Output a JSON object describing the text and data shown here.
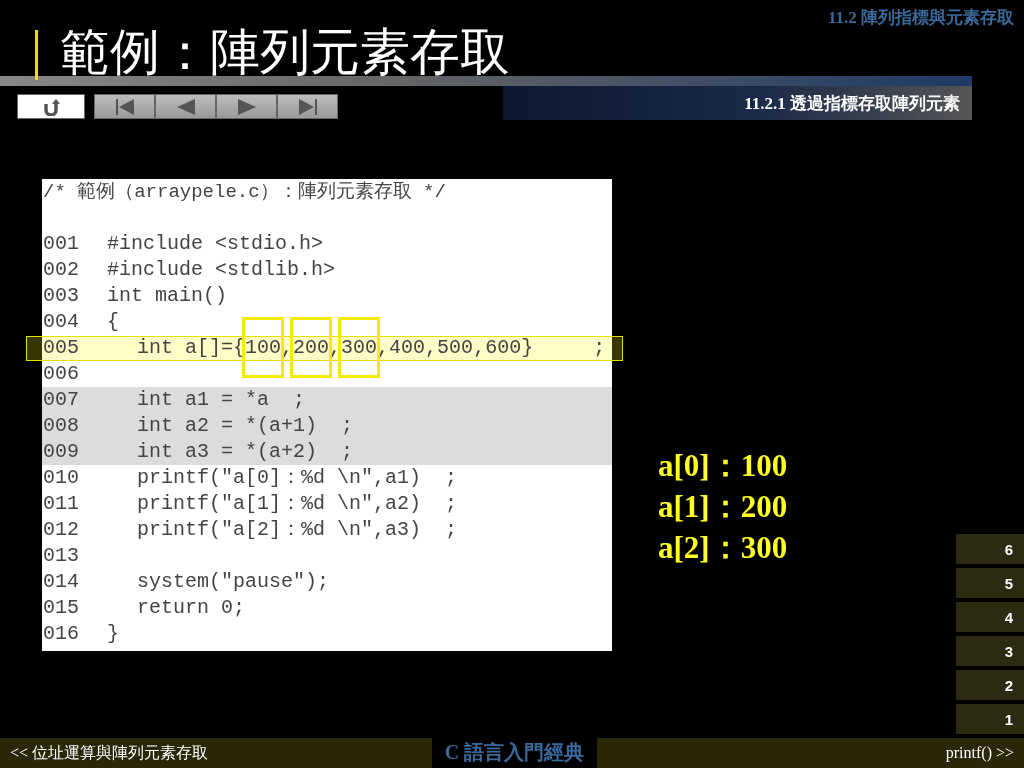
{
  "section_label": "11.2  陣列指標與元素存取",
  "title": "範例：陣列元素存取",
  "nav_buttons": [
    {
      "kind": "home"
    },
    {
      "kind": "first"
    },
    {
      "kind": "prev"
    },
    {
      "kind": "next"
    },
    {
      "kind": "last"
    }
  ],
  "subsection_label": "11.2.1 透過指標存取陣列元素",
  "code": {
    "comment": "/* 範例（arraypele.c）：陣列元素存取 */",
    "lines": [
      {
        "number": "001",
        "indented": false,
        "shaded": false,
        "highlighted": false,
        "segments": [
          {
            "text": "#include <stdio.h>",
            "boxed": false
          }
        ]
      },
      {
        "number": "002",
        "indented": false,
        "shaded": false,
        "highlighted": false,
        "segments": [
          {
            "text": "#include <stdlib.h>",
            "boxed": false
          }
        ]
      },
      {
        "number": "003",
        "indented": false,
        "shaded": false,
        "highlighted": false,
        "segments": [
          {
            "text": "int main()",
            "boxed": false
          }
        ]
      },
      {
        "number": "004",
        "indented": false,
        "shaded": false,
        "highlighted": false,
        "segments": [
          {
            "text": "{",
            "boxed": false
          }
        ]
      },
      {
        "number": "005",
        "indented": true,
        "shaded": false,
        "highlighted": true,
        "segments": [
          {
            "text": "int a[]={",
            "boxed": false
          },
          {
            "text": "100",
            "boxed": true
          },
          {
            "text": ",",
            "boxed": false
          },
          {
            "text": "200",
            "boxed": true
          },
          {
            "text": ",",
            "boxed": false
          },
          {
            "text": "300",
            "boxed": true
          },
          {
            "text": ",400,500,600}     ;",
            "boxed": false
          }
        ]
      },
      {
        "number": "006",
        "shaded": false,
        "highlighted": false
      },
      {
        "number": "007",
        "indented": true,
        "shaded": true,
        "highlighted": false,
        "segments": [
          {
            "text": "int a1 = *a  ;",
            "boxed": false
          }
        ]
      },
      {
        "number": "008",
        "indented": true,
        "shaded": true,
        "highlighted": false,
        "segments": [
          {
            "text": "int a2 = *(a+1)  ;",
            "boxed": false
          }
        ]
      },
      {
        "number": "009",
        "indented": true,
        "shaded": true,
        "highlighted": false,
        "segments": [
          {
            "text": "int a3 = *(a+2)  ;",
            "boxed": false
          }
        ]
      },
      {
        "number": "010",
        "indented": true,
        "shaded": false,
        "highlighted": false,
        "segments": [
          {
            "text": "printf(\"a[0]：%d \\n\",a1)  ;",
            "boxed": false
          }
        ]
      },
      {
        "number": "011",
        "indented": true,
        "shaded": false,
        "highlighted": false,
        "segments": [
          {
            "text": "printf(\"a[1]：%d \\n\",a2)  ;",
            "boxed": false
          }
        ]
      },
      {
        "number": "012",
        "indented": true,
        "shaded": false,
        "highlighted": false,
        "segments": [
          {
            "text": "printf(\"a[2]：%d \\n\",a3)  ;",
            "boxed": false
          }
        ]
      },
      {
        "number": "013",
        "shaded": false,
        "highlighted": false
      },
      {
        "number": "014",
        "indented": true,
        "shaded": false,
        "highlighted": false,
        "segments": [
          {
            "text": "system(\"pause\");",
            "boxed": false
          }
        ]
      },
      {
        "number": "015",
        "indented": true,
        "shaded": false,
        "highlighted": false,
        "segments": [
          {
            "text": "return 0;",
            "boxed": false
          }
        ]
      },
      {
        "number": "016",
        "indented": false,
        "shaded": false,
        "highlighted": false,
        "segments": [
          {
            "text": "}",
            "boxed": false
          }
        ]
      }
    ]
  },
  "output": [
    "a[0]：100",
    "a[1]：200",
    "a[2]：300"
  ],
  "page_buttons": [
    "6",
    "5",
    "4",
    "3",
    "2",
    "1"
  ],
  "footer": {
    "previous": "<< 位址運算與陣列元素存取",
    "book_title": "C 語言入門經典",
    "next": "printf() >>"
  }
}
